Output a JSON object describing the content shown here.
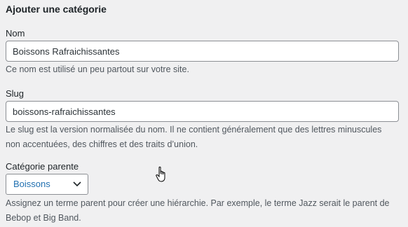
{
  "form": {
    "title": "Ajouter une catégorie",
    "name_label": "Nom",
    "name_value": "Boissons Rafraichissantes",
    "name_desc": "Ce nom est utilisé un peu partout sur votre site.",
    "slug_label": "Slug",
    "slug_value": "boissons-rafraichissantes",
    "slug_desc_line1": "Le slug est la version normalisée du nom. Il ne contient généralement que des lettres minuscules",
    "slug_desc_line2": "non accentuées, des chiffres et des traits d’union.",
    "parent_label": "Catégorie parente",
    "parent_selected": "Boissons",
    "parent_desc_line1": "Assignez un terme parent pour créer une hiérarchie. Par exemple, le terme Jazz serait le parent de",
    "parent_desc_line2": "Bebop et Big Band."
  },
  "icons": {
    "dropdown": "chevron-down-icon",
    "cursor": "hand-pointer-cursor"
  },
  "colors": {
    "background": "#f0f0f1",
    "link_blue": "#2271b1",
    "input_border": "#8c8f94",
    "desc_text": "#50575e"
  }
}
